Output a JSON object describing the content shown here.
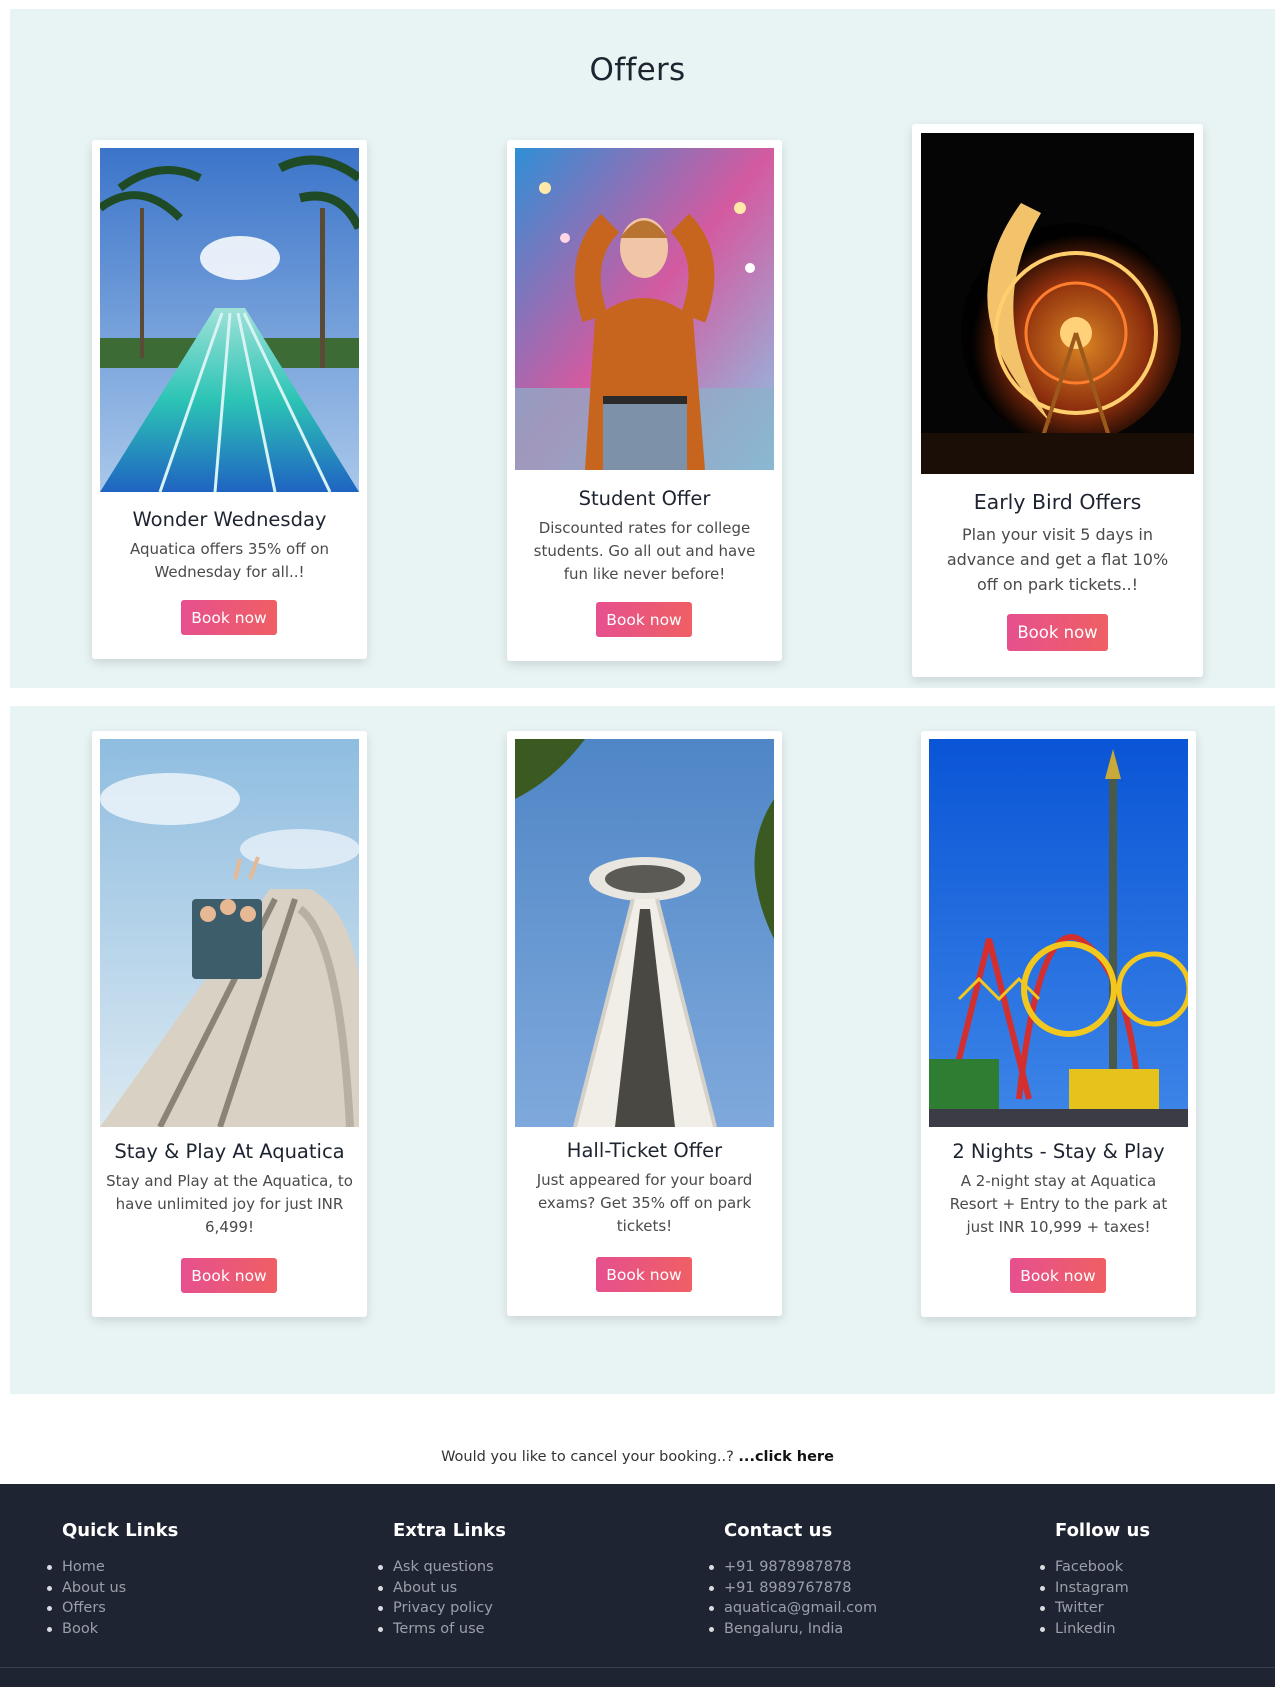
{
  "section": {
    "title": "Offers"
  },
  "cards": [
    {
      "title": "Wonder Wednesday",
      "desc": "Aquatica offers 35% off on Wednesday for all..!",
      "button": "Book now",
      "image": "water-slide-photo"
    },
    {
      "title": "Student Offer",
      "desc": "Discounted rates for college students. Go all out and have fun like never before!",
      "button": "Book now",
      "image": "student-carnival-photo"
    },
    {
      "title": "Early Bird Offers",
      "desc": "Plan your visit 5 days in advance and get a flat 10% off on park tickets..!",
      "button": "Book now",
      "image": "ferris-wheel-night-photo"
    },
    {
      "title": "Stay & Play At Aquatica",
      "desc": "Stay and Play at the Aquatica, to have unlimited joy for just INR 6,499!",
      "button": "Book now",
      "image": "roller-coaster-photo"
    },
    {
      "title": "Hall-Ticket Offer",
      "desc": "Just appeared for your board exams? Get 35% off on park tickets!",
      "button": "Book now",
      "image": "space-needle-photo"
    },
    {
      "title": "2 Nights - Stay & Play",
      "desc": "A 2-night stay at Aquatica Resort + Entry to the park at just INR 10,999 + taxes!",
      "button": "Book now",
      "image": "amusement-rides-photo"
    }
  ],
  "cancel": {
    "text": "Would you like to cancel your booking..? ",
    "link": "...click here"
  },
  "footer": {
    "columns": [
      {
        "heading": "Quick Links",
        "items": [
          "Home",
          "About us",
          "Offers",
          "Book"
        ]
      },
      {
        "heading": "Extra Links",
        "items": [
          "Ask questions",
          "About us",
          "Privacy policy",
          "Terms of use"
        ]
      },
      {
        "heading": "Contact us",
        "items": [
          "+91 9878987878",
          "+91 8989767878",
          "aquatica@gmail.com",
          "Bengaluru, India"
        ]
      },
      {
        "heading": "Follow us",
        "items": [
          "Facebook",
          "Instagram",
          "Twitter",
          "Linkedin"
        ]
      }
    ]
  },
  "colors": {
    "band": "#e8f3f3",
    "button_start": "#e6508f",
    "button_end": "#ef5f63",
    "footer": "#1f2432"
  }
}
